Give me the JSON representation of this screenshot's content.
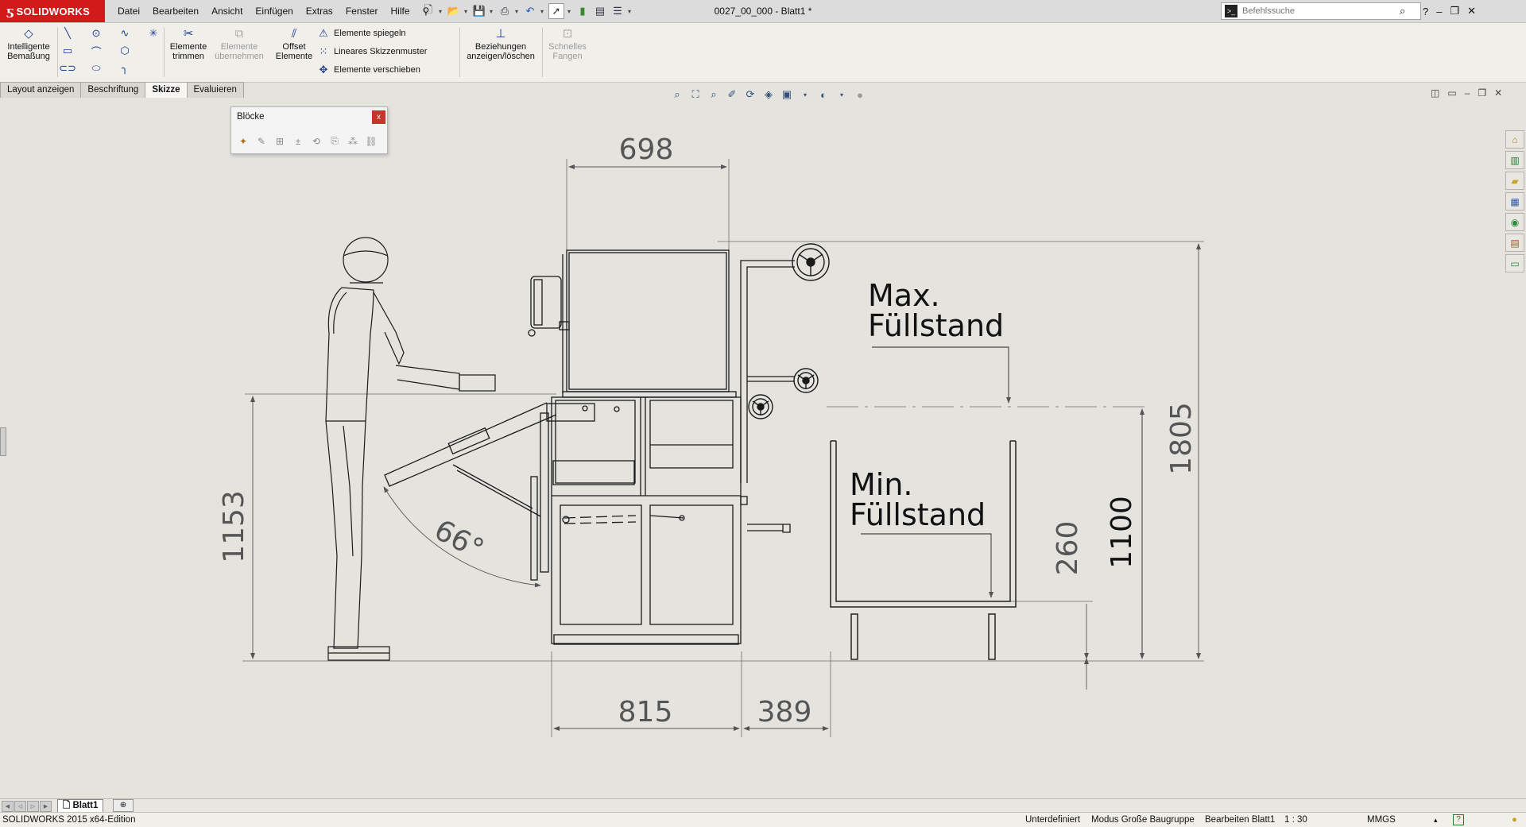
{
  "app": {
    "brand": "SOLIDWORKS",
    "document_title": "0027_00_000 - Blatt1 *"
  },
  "menu": [
    "Datei",
    "Bearbeiten",
    "Ansicht",
    "Einfügen",
    "Extras",
    "Fenster",
    "Hilfe"
  ],
  "search": {
    "placeholder": "Befehlssuche"
  },
  "ribbon": {
    "smart_dimension": "Intelligente Bemaßung",
    "trim_entities": "Elemente trimmen",
    "convert_entities": "Elemente übernehmen",
    "offset_entities": "Offset Elemente",
    "mirror_entities": "Elemente spiegeln",
    "linear_pattern": "Lineares Skizzenmuster",
    "move_entities": "Elemente verschieben",
    "relations": "Beziehungen anzeigen/löschen",
    "quick_snaps": "Schnelles Fangen"
  },
  "tabs": [
    {
      "label": "Layout anzeigen",
      "active": false
    },
    {
      "label": "Beschriftung",
      "active": false
    },
    {
      "label": "Skizze",
      "active": true
    },
    {
      "label": "Evaluieren",
      "active": false
    }
  ],
  "blocks_panel": {
    "title": "Blöcke",
    "close": "x"
  },
  "drawing": {
    "dims": {
      "width_top": "698",
      "height_total": "1805",
      "height_1153": "1153",
      "angle": "66°",
      "width_815": "815",
      "width_389": "389",
      "height_1100": "1100",
      "height_260": "260"
    },
    "max_label_line1": "Max.",
    "max_label_line2": "Füllstand",
    "min_label_line1": "Min.",
    "min_label_line2": "Füllstand"
  },
  "sheet": {
    "tab": "Blatt1"
  },
  "status": {
    "edition": "SOLIDWORKS 2015 x64-Edition",
    "state": "Unterdefiniert",
    "mode": "Modus Große Baugruppe",
    "editing": "Bearbeiten Blatt1",
    "scale": "1 : 30",
    "units": "MMGS"
  },
  "colors": {
    "brand_red": "#d21a1a",
    "sheet": "#e4e3de",
    "ribbon": "#f0efea",
    "icon_blue": "#1a3b8f"
  }
}
